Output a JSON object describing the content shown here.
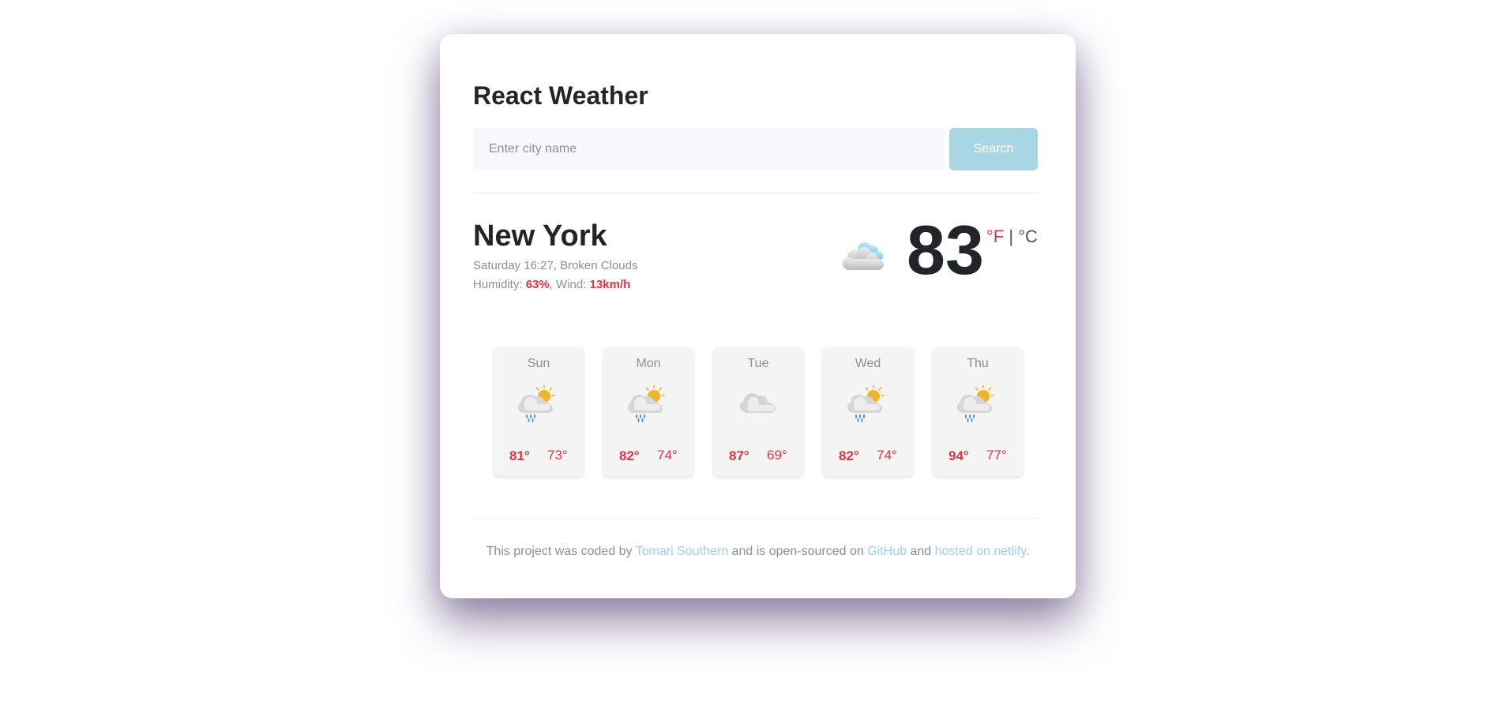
{
  "app": {
    "title": "React Weather"
  },
  "search": {
    "placeholder": "Enter city name",
    "value": "",
    "button_label": "Search"
  },
  "current": {
    "city": "New York",
    "datetime": "Saturday 16:27",
    "separator": ", ",
    "description": "Broken Clouds",
    "humidity_label": "Humidity: ",
    "humidity_value": "63%",
    "wind_label": ", Wind: ",
    "wind_value": "13km/h",
    "temperature": "83",
    "unit_f": "°F",
    "unit_separator": " | ",
    "unit_c": "°C",
    "icon": "broken-clouds-icon"
  },
  "forecast": [
    {
      "day": "Sun",
      "high": "81°",
      "low": "73°",
      "icon": "rain-sun-icon"
    },
    {
      "day": "Mon",
      "high": "82°",
      "low": "74°",
      "icon": "rain-sun-icon"
    },
    {
      "day": "Tue",
      "high": "87°",
      "low": "69°",
      "icon": "cloud-icon"
    },
    {
      "day": "Wed",
      "high": "82°",
      "low": "74°",
      "icon": "rain-sun-icon"
    },
    {
      "day": "Thu",
      "high": "94°",
      "low": "77°",
      "icon": "rain-sun-icon"
    }
  ],
  "footer": {
    "text1": "This project was coded by ",
    "author_link": "Tomari Southern",
    "text2": " and is open-sourced on ",
    "github_link": "GitHub",
    "text3": " and ",
    "netlify_link": "hosted on netlify."
  },
  "colors": {
    "accent_red": "#dc3545",
    "button_blue": "#a9d6e5",
    "link_blue": "#9dcfe2",
    "muted_text": "#8a8f96"
  }
}
